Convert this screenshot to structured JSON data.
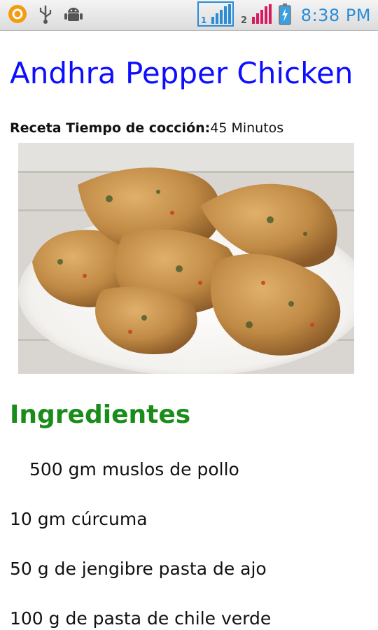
{
  "status_bar": {
    "time": "8:38 PM",
    "sim1_label": "1",
    "sim2_label": "2",
    "icons": [
      "notification-circle-icon",
      "usb-icon",
      "android-debug-icon",
      "signal-sim1-icon",
      "signal-sim2-icon",
      "battery-charging-icon"
    ],
    "colors": {
      "time": "#2a8bd6",
      "sim1": "#2a8bd6",
      "sim2": "#d81b60",
      "notification": "#f39c12"
    }
  },
  "recipe": {
    "title": "Andhra Pepper Chicken",
    "cook_label": "Receta Tiempo de cocción:",
    "cook_value": "45 Minutos",
    "image_subject": "fried-chicken-photo"
  },
  "ingredients_section": {
    "heading": "Ingredientes",
    "items": [
      "500 gm muslos de pollo",
      "10 gm cúrcuma",
      "50 g de jengibre pasta de ajo",
      "100 g de pasta de chile verde"
    ]
  },
  "colors": {
    "title": "#0d0dff",
    "section_heading": "#1a8c1a"
  }
}
